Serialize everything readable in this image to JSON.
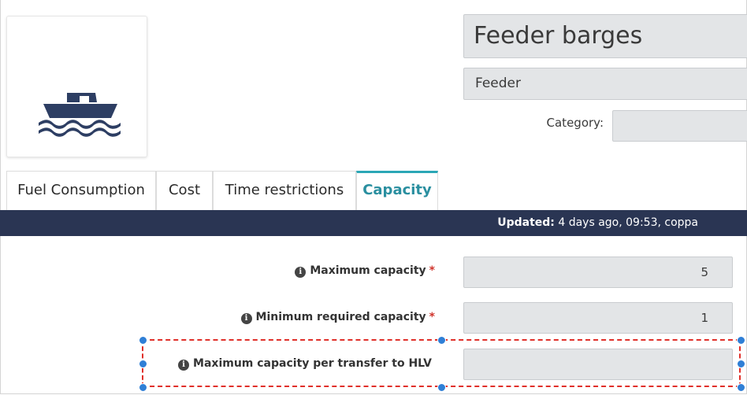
{
  "header": {
    "title": "Feeder barges",
    "subtitle": "Feeder",
    "category_label": "Category:",
    "category_value": "",
    "logo_icon": "ship-icon"
  },
  "tabs": [
    {
      "label": "Fuel Consumption",
      "active": false
    },
    {
      "label": "Cost",
      "active": false
    },
    {
      "label": "Time restrictions",
      "active": false
    },
    {
      "label": "Capacity",
      "active": true
    }
  ],
  "updated": {
    "label": "Updated:",
    "value": "4 days ago, 09:53, coppa"
  },
  "form": {
    "rows": [
      {
        "label": "Maximum capacity",
        "required": "*",
        "value": "5"
      },
      {
        "label": "Minimum required capacity",
        "required": "*",
        "value": "1"
      },
      {
        "label": "Maximum capacity per transfer to HLV",
        "required": "",
        "value": ""
      }
    ]
  },
  "colors": {
    "accent": "#2ba7b6",
    "header_bar": "#2a3553",
    "required": "#d0342c",
    "selection": "#e0302a",
    "handle": "#2f7fd6"
  }
}
